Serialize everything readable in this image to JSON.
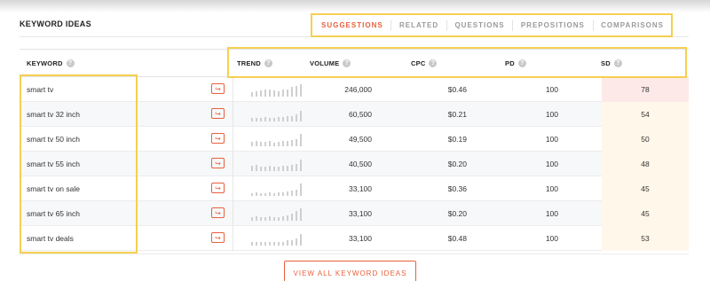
{
  "panel": {
    "title": "KEYWORD IDEAS"
  },
  "tabs": [
    {
      "label": "SUGGESTIONS",
      "active": true
    },
    {
      "label": "RELATED",
      "active": false
    },
    {
      "label": "QUESTIONS",
      "active": false
    },
    {
      "label": "PREPOSITIONS",
      "active": false
    },
    {
      "label": "COMPARISONS",
      "active": false
    }
  ],
  "columns": {
    "keyword": "KEYWORD",
    "trend": "TREND",
    "volume": "VOLUME",
    "cpc": "CPC",
    "pd": "PD",
    "sd": "SD"
  },
  "help_glyph": "?",
  "link_glyph": "↪",
  "rows": [
    {
      "keyword": "smart tv",
      "volume": "246,000",
      "cpc": "$0.46",
      "pd": "100",
      "sd": "78",
      "trend": [
        0.35,
        0.45,
        0.5,
        0.6,
        0.55,
        0.5,
        0.45,
        0.55,
        0.6,
        0.75,
        0.85,
        1.0
      ]
    },
    {
      "keyword": "smart tv 32 inch",
      "volume": "60,500",
      "cpc": "$0.21",
      "pd": "100",
      "sd": "54",
      "trend": [
        0.25,
        0.3,
        0.3,
        0.35,
        0.3,
        0.3,
        0.35,
        0.35,
        0.4,
        0.45,
        0.55,
        0.85
      ]
    },
    {
      "keyword": "smart tv 50 inch",
      "volume": "49,500",
      "cpc": "$0.19",
      "pd": "100",
      "sd": "50",
      "trend": [
        0.35,
        0.4,
        0.35,
        0.35,
        0.4,
        0.3,
        0.35,
        0.4,
        0.45,
        0.5,
        0.6,
        1.0
      ]
    },
    {
      "keyword": "smart tv 55 inch",
      "volume": "40,500",
      "cpc": "$0.20",
      "pd": "100",
      "sd": "48",
      "trend": [
        0.45,
        0.5,
        0.35,
        0.35,
        0.4,
        0.35,
        0.35,
        0.4,
        0.45,
        0.5,
        0.55,
        0.95
      ]
    },
    {
      "keyword": "smart tv on sale",
      "volume": "33,100",
      "cpc": "$0.36",
      "pd": "100",
      "sd": "45",
      "trend": [
        0.2,
        0.25,
        0.2,
        0.2,
        0.25,
        0.2,
        0.25,
        0.3,
        0.35,
        0.4,
        0.5,
        1.0
      ]
    },
    {
      "keyword": "smart tv 65 inch",
      "volume": "33,100",
      "cpc": "$0.20",
      "pd": "100",
      "sd": "45",
      "trend": [
        0.3,
        0.35,
        0.3,
        0.3,
        0.35,
        0.3,
        0.3,
        0.35,
        0.45,
        0.55,
        0.75,
        1.0
      ]
    },
    {
      "keyword": "smart tv deals",
      "volume": "33,100",
      "cpc": "$0.48",
      "pd": "100",
      "sd": "53",
      "trend": [
        0.25,
        0.3,
        0.25,
        0.25,
        0.3,
        0.25,
        0.3,
        0.3,
        0.4,
        0.45,
        0.55,
        0.9
      ]
    }
  ],
  "footer": {
    "button": "VIEW ALL KEYWORD IDEAS"
  },
  "colors": {
    "accent": "#e8603c",
    "highlight": "#f5cf50",
    "sd_high": "#fde9e7",
    "sd_mid": "#fff7e9"
  }
}
